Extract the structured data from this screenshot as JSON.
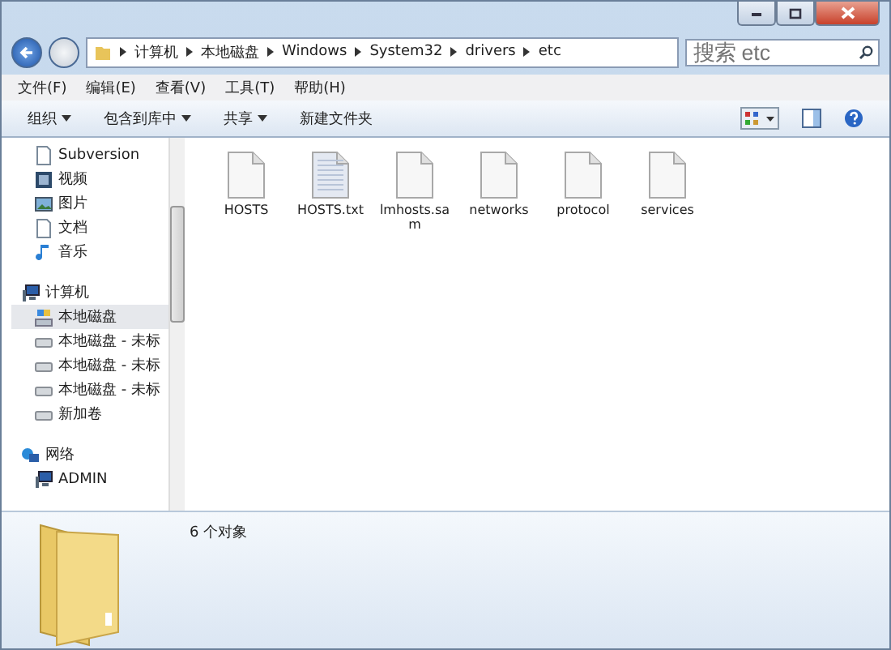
{
  "address_bar": {
    "segments": [
      "计算机",
      "本地磁盘",
      "Windows",
      "System32",
      "drivers",
      "etc"
    ]
  },
  "search": {
    "placeholder": "搜索 etc"
  },
  "menu_bar": [
    "文件(F)",
    "编辑(E)",
    "查看(V)",
    "工具(T)",
    "帮助(H)"
  ],
  "toolbar": [
    {
      "label": "组织",
      "dropdown": true
    },
    {
      "label": "包含到库中",
      "dropdown": true
    },
    {
      "label": "共享",
      "dropdown": true
    },
    {
      "label": "新建文件夹",
      "dropdown": false
    }
  ],
  "sidebar": {
    "groups": [
      {
        "children": [
          {
            "label": "Subversion",
            "kind": "doc",
            "selected": false
          },
          {
            "label": "视频",
            "kind": "video",
            "selected": false
          },
          {
            "label": "图片",
            "kind": "picture",
            "selected": false
          },
          {
            "label": "文档",
            "kind": "doc",
            "selected": false
          },
          {
            "label": "音乐",
            "kind": "music",
            "selected": false
          }
        ]
      },
      {
        "label": "计算机",
        "kind": "computer",
        "children": [
          {
            "label": "本地磁盘",
            "kind": "system-drive",
            "selected": true
          },
          {
            "label": "本地磁盘 - 未标",
            "kind": "drive",
            "selected": false
          },
          {
            "label": "本地磁盘 - 未标",
            "kind": "drive",
            "selected": false
          },
          {
            "label": "本地磁盘 - 未标",
            "kind": "drive",
            "selected": false
          },
          {
            "label": "新加卷",
            "kind": "drive",
            "selected": false
          }
        ]
      },
      {
        "label": "网络",
        "kind": "network",
        "children": [
          {
            "label": "ADMIN",
            "kind": "computer",
            "selected": false
          }
        ]
      }
    ]
  },
  "files": [
    {
      "name": "HOSTS",
      "kind": "file"
    },
    {
      "name": "HOSTS.txt",
      "kind": "text"
    },
    {
      "name": "lmhosts.sam",
      "kind": "file"
    },
    {
      "name": "networks",
      "kind": "file"
    },
    {
      "name": "protocol",
      "kind": "file"
    },
    {
      "name": "services",
      "kind": "file"
    }
  ],
  "details_pane": {
    "summary": "6 个对象"
  }
}
